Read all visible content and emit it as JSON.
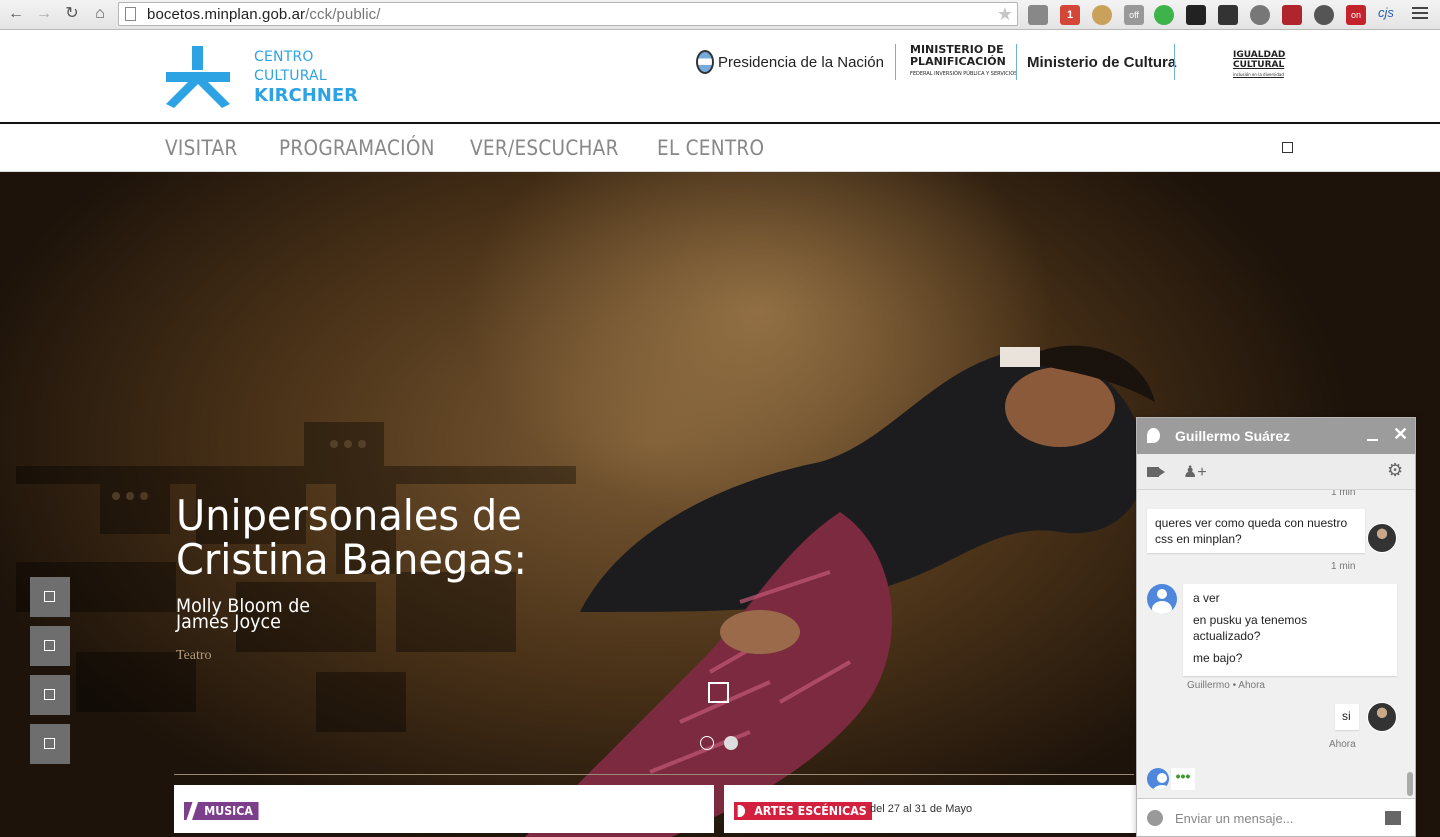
{
  "browser": {
    "url_host": "bocetos.minplan.gob.ar",
    "url_path": "/cck/public/",
    "profile": "cjs",
    "ext_badges": {
      "gmail": "1",
      "off": "off",
      "on": "on"
    }
  },
  "site": {
    "logo": {
      "line1": "CENTRO",
      "line2": "CULTURAL",
      "line3": "KIRCHNER"
    },
    "gov": {
      "presidencia": "Presidencia de la Nación",
      "minplan_1": "MINISTERIO DE",
      "minplan_2": "PLANIFICACIÓN",
      "minplan_3": "FEDERAL INVERSIÓN PÚBLICA Y SERVICIOS",
      "cultura": "Ministerio de Cultura",
      "igualdad_1": "IGUALDAD",
      "igualdad_2": "CULTURAL",
      "igualdad_3": "inclusión en la diversidad"
    },
    "nav": [
      "VISITAR",
      "PROGRAMACIÓN",
      "VER/ESCUCHAR",
      "EL CENTRO"
    ]
  },
  "hero": {
    "title_1": "Unipersonales de",
    "title_2": "Cristina Banegas:",
    "subtitle_1": "Molly Bloom de",
    "subtitle_2": "James Joyce",
    "category": "Teatro"
  },
  "cards": [
    {
      "tag": "MUSICA",
      "color": "#7b3f8c"
    },
    {
      "tag": "ARTES ESCÉNICAS",
      "date": "del 27 al 31 de Mayo",
      "color": "#d2203e"
    }
  ],
  "chat": {
    "contact": "Guillermo Suárez",
    "ts_top": "1 min",
    "msg_out_1": "queres ver como queda con nuestro css en minplan?",
    "ts_mid": "1 min",
    "msg_in_1": "a ver",
    "msg_in_2": "en pusku ya tenemos actualizado?",
    "msg_in_3": "me bajo?",
    "in_meta": "Guillermo • Ahora",
    "msg_out_2": "si",
    "out_meta": "Ahora",
    "typing": "•••",
    "placeholder": "Enviar un mensaje..."
  }
}
